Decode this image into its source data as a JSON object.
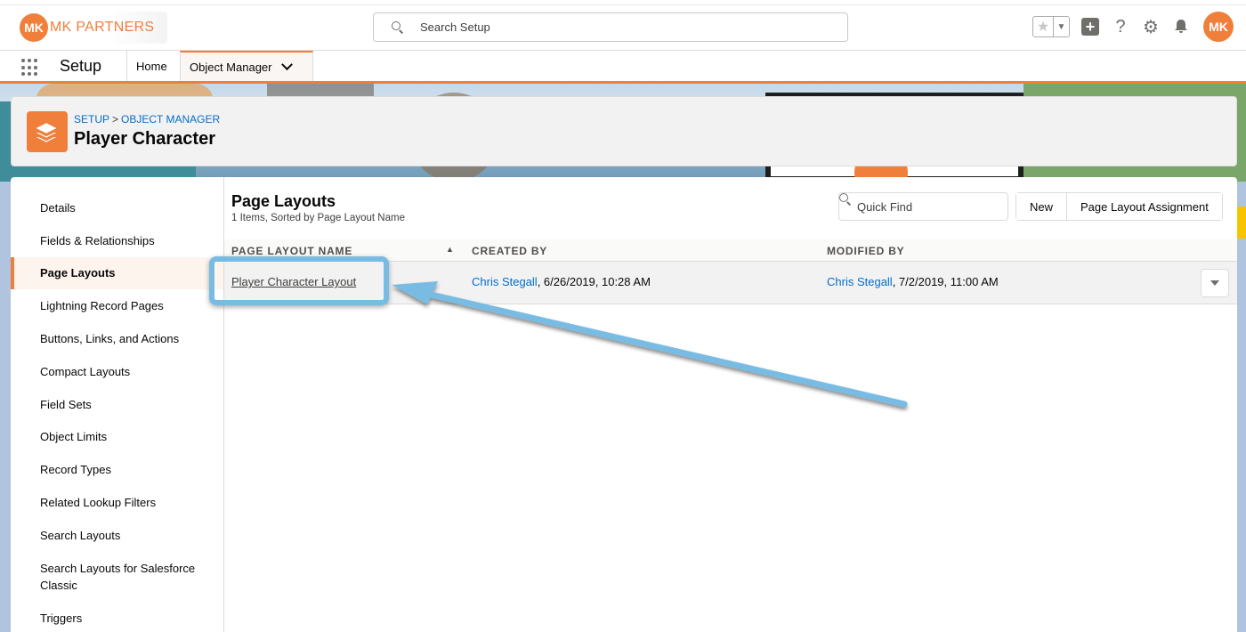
{
  "logo": {
    "mark": "MK",
    "text": "MK PARTNERS"
  },
  "search": {
    "placeholder": "Search Setup"
  },
  "header_icons": [
    "star-icon",
    "dropdown-icon",
    "plus-icon",
    "help-icon",
    "gear-icon",
    "bell-icon",
    "avatar"
  ],
  "avatar": {
    "initials": "MK"
  },
  "context_bar": {
    "app_name": "Setup",
    "tabs": [
      {
        "label": "Home"
      },
      {
        "label": "Object Manager"
      }
    ]
  },
  "object_header": {
    "breadcrumb": [
      "SETUP",
      "OBJECT MANAGER"
    ],
    "separator": ">",
    "title": "Player Character"
  },
  "sidebar": {
    "items": [
      {
        "label": "Details"
      },
      {
        "label": "Fields & Relationships"
      },
      {
        "label": "Page Layouts"
      },
      {
        "label": "Lightning Record Pages"
      },
      {
        "label": "Buttons, Links, and Actions"
      },
      {
        "label": "Compact Layouts"
      },
      {
        "label": "Field Sets"
      },
      {
        "label": "Object Limits"
      },
      {
        "label": "Record Types"
      },
      {
        "label": "Related Lookup Filters"
      },
      {
        "label": "Search Layouts"
      },
      {
        "label": "Search Layouts for Salesforce Classic"
      },
      {
        "label": "Triggers"
      }
    ],
    "active": "Page Layouts"
  },
  "content": {
    "title": "Page Layouts",
    "subtitle": "1 Items, Sorted by Page Layout Name",
    "quick_find_placeholder": "Quick Find",
    "buttons": {
      "new": "New",
      "assignment": "Page Layout Assignment"
    },
    "columns": [
      "PAGE LAYOUT NAME",
      "CREATED BY",
      "MODIFIED BY"
    ],
    "rows": [
      {
        "name": "Player Character Layout",
        "created_by_user": "Chris Stegall",
        "created_by_date": ", 6/26/2019, 10:28 AM",
        "modified_by_user": "Chris Stegall",
        "modified_by_date": ", 7/2/2019, 11:00 AM"
      }
    ]
  },
  "colors": {
    "brand": "#f07f3c",
    "link": "#006dcc",
    "annotation": "#79bce3"
  }
}
